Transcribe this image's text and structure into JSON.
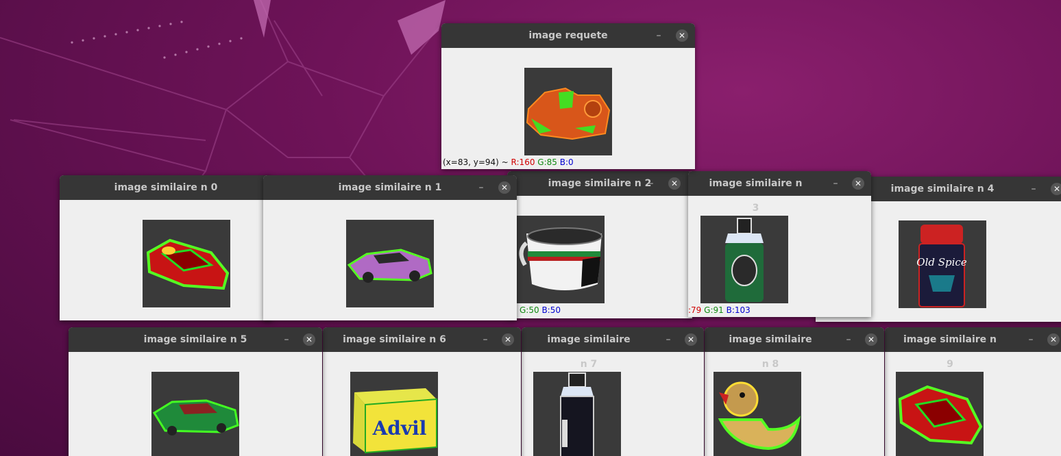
{
  "desktop": {
    "wallpaper": "ubuntu-focal-fossa",
    "colors": {
      "background": "#6e1358",
      "titlebar": "#363636",
      "window_body": "#efefef"
    }
  },
  "controls": {
    "minimize_glyph": "–",
    "close_glyph": "✕"
  },
  "windows": {
    "query": {
      "title": "image requete",
      "status": {
        "coords": "(x=83, y=94) ~",
        "r": "R:160",
        "g": "G:85",
        "b": "B:0"
      }
    },
    "s0": {
      "title": "image similaire n 0"
    },
    "s1": {
      "title": "image similaire n 1"
    },
    "s2": {
      "title": "image similaire n 2",
      "status": {
        "g": "G:50",
        "b": "B:50"
      }
    },
    "s3": {
      "title": "image similaire n 3",
      "status": {
        "r": ":79",
        "g": "G:91",
        "b": "B:103"
      }
    },
    "s4": {
      "title": "image similaire n 4"
    },
    "s5": {
      "title": "image similaire n 5"
    },
    "s6": {
      "title": "image similaire n 6"
    },
    "s7": {
      "title": "image similaire n 7"
    },
    "s8": {
      "title": "image similaire n 8"
    },
    "s9": {
      "title": "image similaire n 9"
    }
  },
  "thumbnails": {
    "query": "orange-toy-car",
    "s0": "red-green-sports-car",
    "s1": "purple-green-race-car",
    "s2": "striped-coffee-cup",
    "s3": "green-spray-bottle",
    "s4": "old-spice-deodorant",
    "s5": "green-toy-car",
    "s6": "advil-box",
    "s7": "black-bottle",
    "s8": "rubber-duck",
    "s9": "red-green-car-2"
  },
  "product_labels": {
    "s4": "Old Spice",
    "s6": "Advil"
  }
}
